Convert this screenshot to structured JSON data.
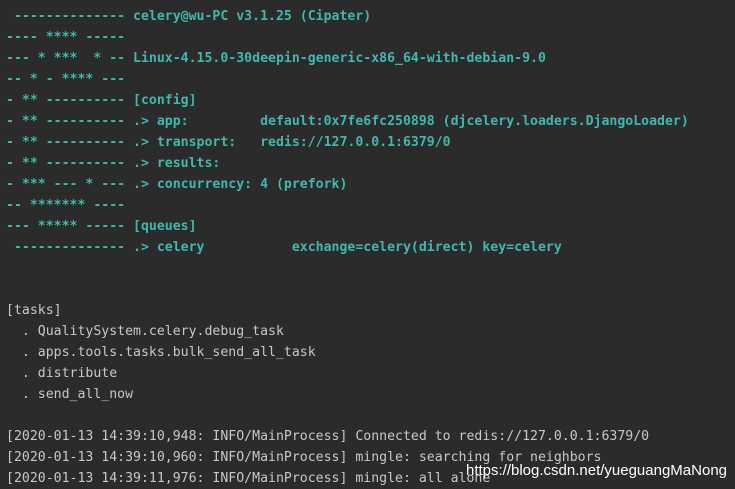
{
  "banner": [
    " -------------- celery@wu-PC v3.1.25 (Cipater)",
    "---- **** -----",
    "--- * ***  * -- Linux-4.15.0-30deepin-generic-x86_64-with-debian-9.0",
    "-- * - **** ---",
    "- ** ---------- [config]",
    "- ** ---------- .> app:         default:0x7fe6fc250898 (djcelery.loaders.DjangoLoader)",
    "- ** ---------- .> transport:   redis://127.0.0.1:6379/0",
    "- ** ---------- .> results:",
    "- *** --- * --- .> concurrency: 4 (prefork)",
    "-- ******* ----",
    "--- ***** ----- [queues]",
    " -------------- .> celery           exchange=celery(direct) key=celery"
  ],
  "tasks_header": "[tasks]",
  "tasks": [
    "  . QualitySystem.celery.debug_task",
    "  . apps.tools.tasks.bulk_send_all_task",
    "  . distribute",
    "  . send_all_now"
  ],
  "log": [
    "[2020-01-13 14:39:10,948: INFO/MainProcess] Connected to redis://127.0.0.1:6379/0",
    "[2020-01-13 14:39:10,960: INFO/MainProcess] mingle: searching for neighbors",
    "[2020-01-13 14:39:11,976: INFO/MainProcess] mingle: all alone"
  ],
  "watermark": "https://blog.csdn.net/yueguangMaNong",
  "colors": {
    "background": "#2b2b2b",
    "banner_text": "#3fb9b0",
    "plain_text": "#c8c8c8"
  }
}
